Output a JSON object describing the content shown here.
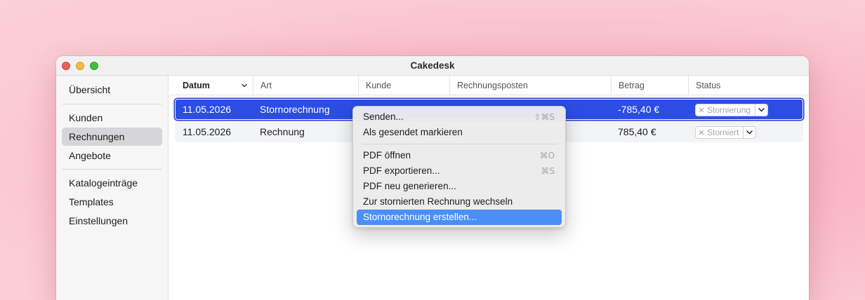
{
  "window": {
    "title": "Cakedesk"
  },
  "sidebar": {
    "groups": [
      [
        {
          "label": "Übersicht"
        }
      ],
      [
        {
          "label": "Kunden"
        },
        {
          "label": "Rechnungen",
          "selected": true
        },
        {
          "label": "Angebote"
        }
      ],
      [
        {
          "label": "Katalogeinträge"
        },
        {
          "label": "Templates"
        },
        {
          "label": "Einstellungen"
        }
      ]
    ]
  },
  "table": {
    "columns": [
      "Datum",
      "Art",
      "Kunde",
      "Rechnungsposten",
      "Betrag",
      "Status"
    ],
    "rows": [
      {
        "datum": "11.05.2026",
        "art": "Stornorechnung",
        "kunde": "",
        "posten": "",
        "betrag": "-785,40 €",
        "status": "Stornierung",
        "selected": true
      },
      {
        "datum": "11.05.2026",
        "art": "Rechnung",
        "kunde": "",
        "posten": "",
        "betrag": "785,40 €",
        "status": "Storniert",
        "selected": false
      }
    ]
  },
  "context_menu": {
    "items": [
      {
        "label": "Senden...",
        "shortcut": "⇧⌘S"
      },
      {
        "label": "Als gesendet markieren",
        "shortcut": ""
      },
      {
        "separator": true
      },
      {
        "label": "PDF öffnen",
        "shortcut": "⌘O"
      },
      {
        "label": "PDF exportieren...",
        "shortcut": "⌘S"
      },
      {
        "label": "PDF neu generieren...",
        "shortcut": ""
      },
      {
        "label": "Zur stornierten Rechnung wechseln",
        "shortcut": ""
      },
      {
        "label": "Stornorechnung erstellen...",
        "shortcut": "",
        "highlighted": true
      }
    ]
  },
  "colors": {
    "selection": "#2c4de4",
    "menu_highlight": "#4b8ff5",
    "close": "#ed5f57",
    "minimize": "#f4bd3a",
    "maximize": "#3ec03c"
  }
}
